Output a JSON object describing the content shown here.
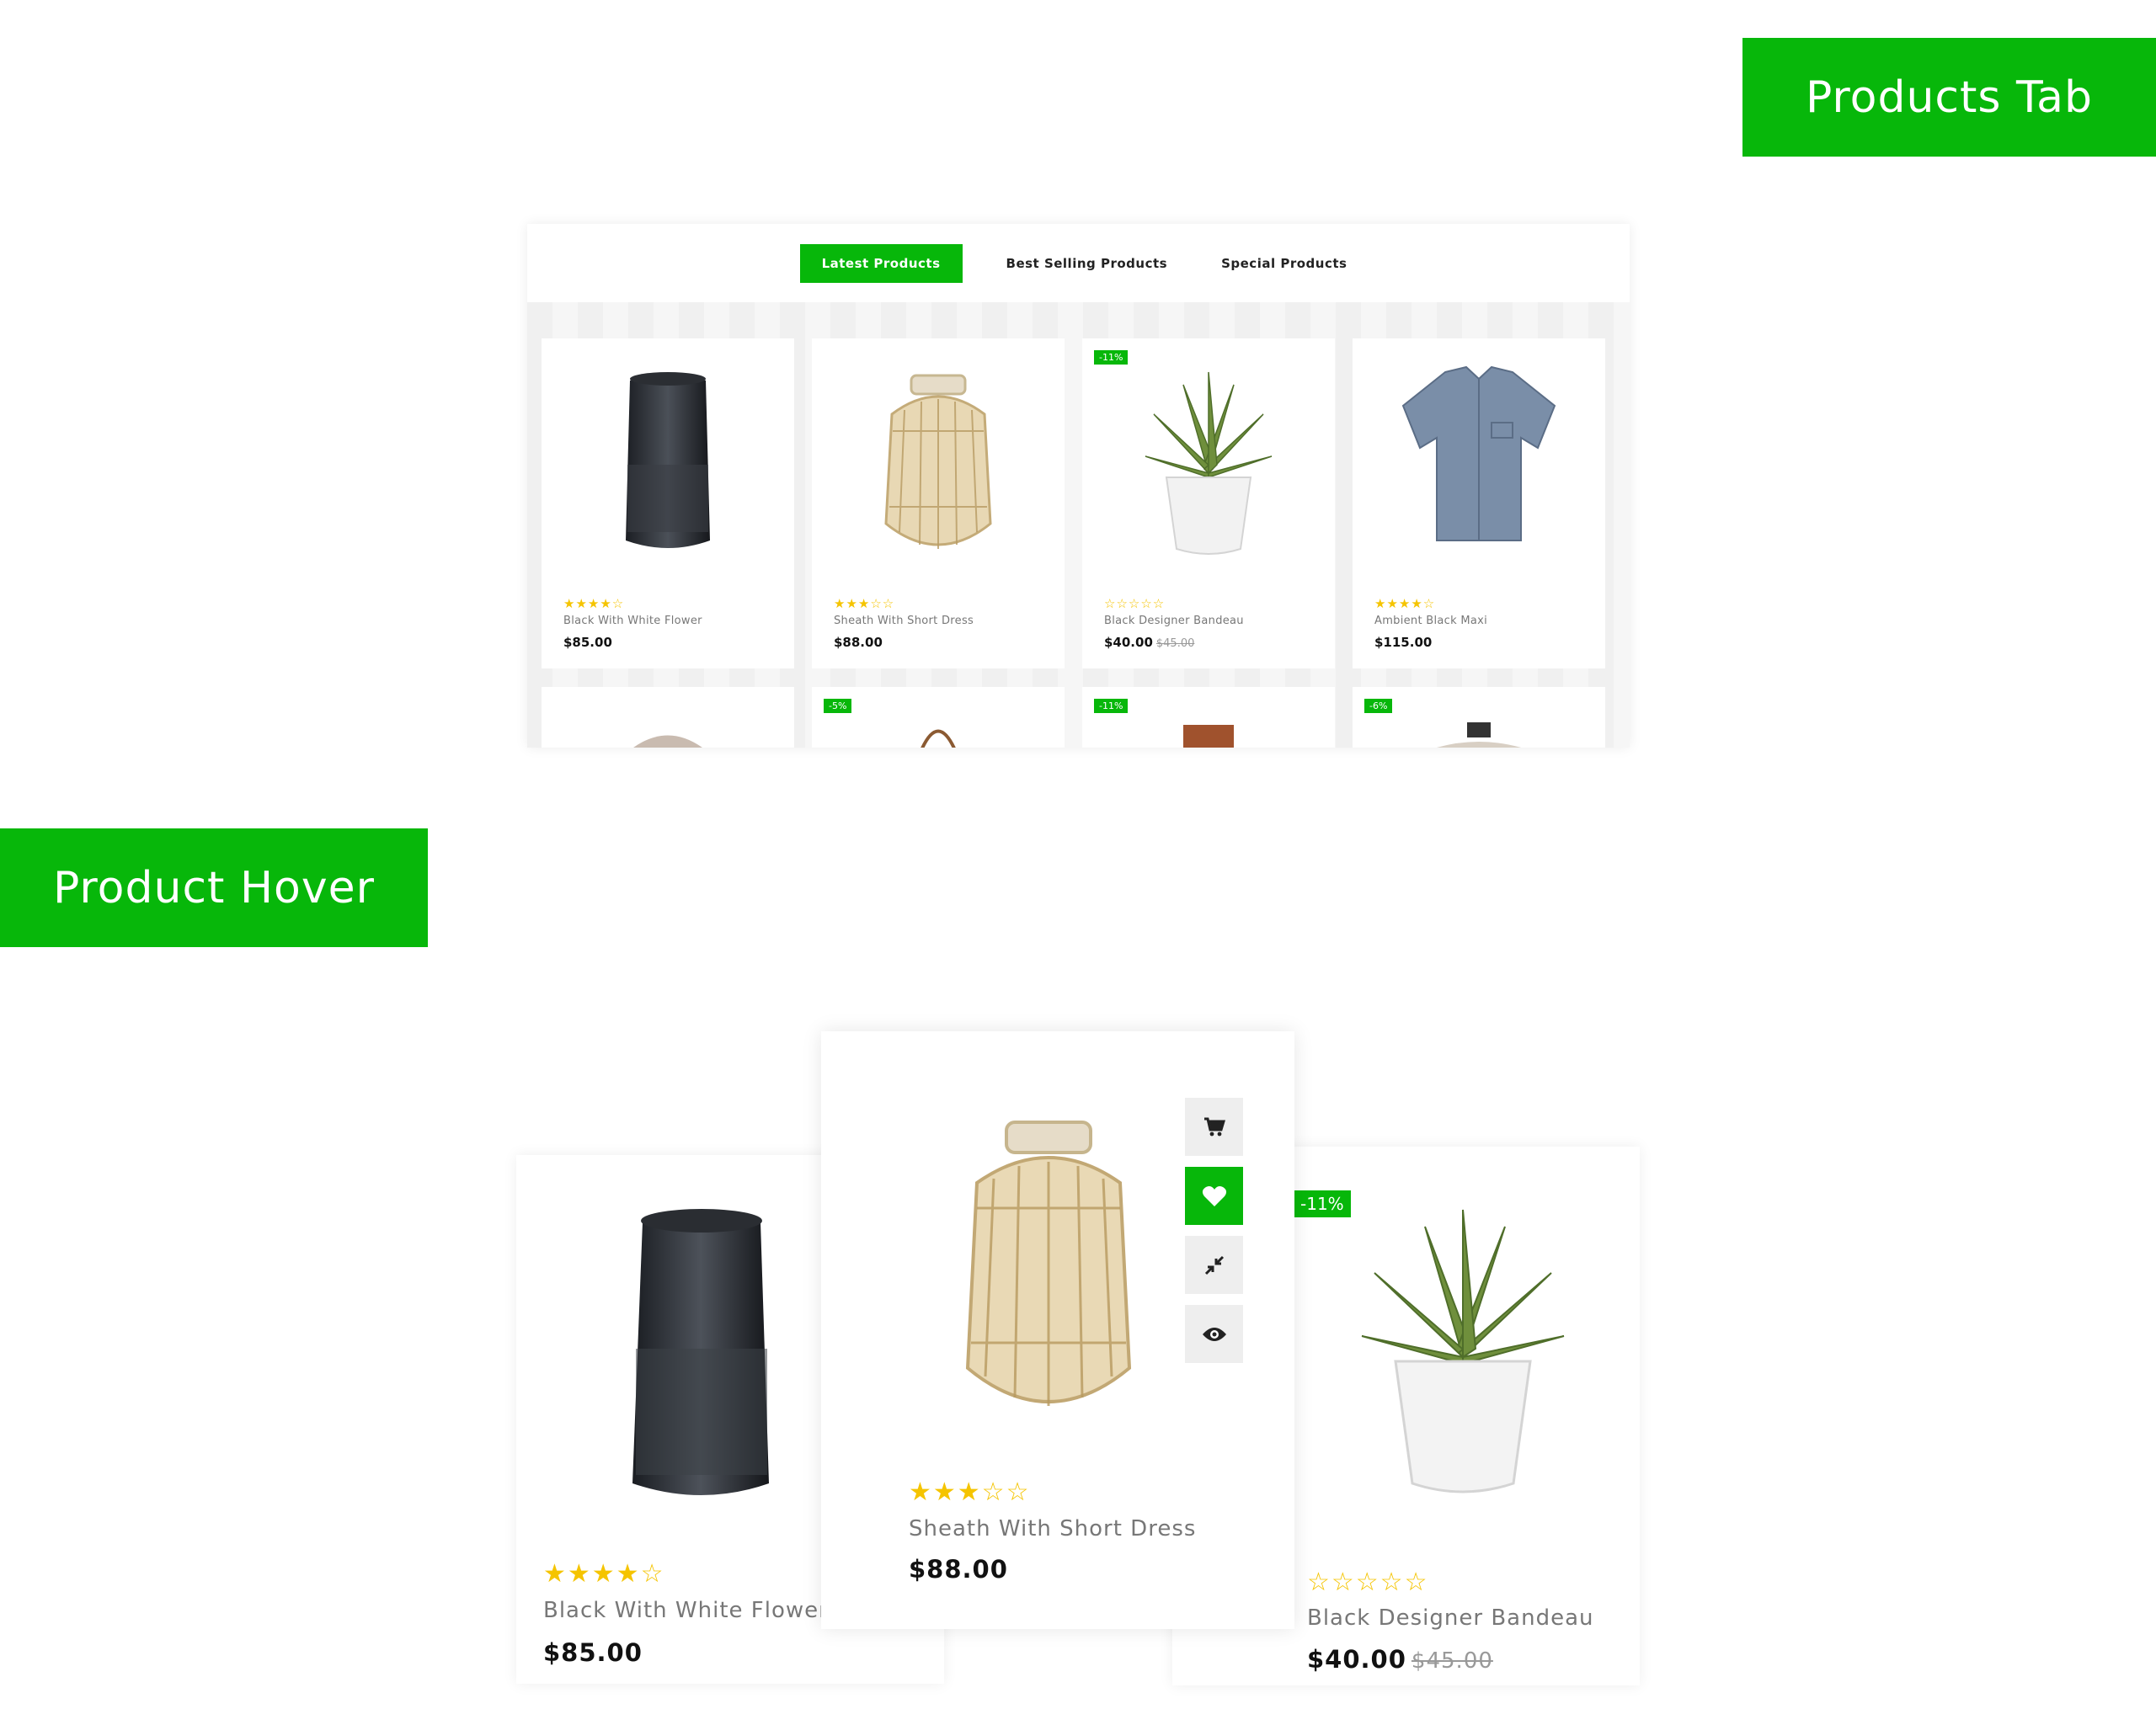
{
  "banners": {
    "products_tab": "Products Tab",
    "product_hover": "Product Hover"
  },
  "tabs": [
    {
      "label": "Latest Products",
      "active": true
    },
    {
      "label": "Best Selling Products",
      "active": false
    },
    {
      "label": "Special Products",
      "active": false
    }
  ],
  "grid_products": [
    {
      "name": "Black With White Flower",
      "price": "$85.00",
      "old_price": "",
      "stars": "★★★★☆",
      "rating": 4,
      "badge": "",
      "image": "speaker"
    },
    {
      "name": "Sheath With Short Dress",
      "price": "$88.00",
      "old_price": "",
      "stars": "★★★☆☆",
      "rating": 3,
      "badge": "",
      "image": "lantern"
    },
    {
      "name": "Black Designer Bandeau",
      "price": "$40.00",
      "old_price": "$45.00",
      "stars": "☆☆☆☆☆",
      "rating": 0,
      "badge": "-11%",
      "image": "plant"
    },
    {
      "name": "Ambient Black Maxi",
      "price": "$115.00",
      "old_price": "",
      "stars": "★★★★☆",
      "rating": 4,
      "badge": "",
      "image": "shirt"
    }
  ],
  "second_row_badges": [
    "",
    "-5%",
    "-11%",
    "-6%"
  ],
  "hover_products": [
    {
      "name": "Black With White Flower",
      "price": "$85.00",
      "old_price": "",
      "stars": "★★★★☆",
      "rating": 4,
      "badge": "",
      "image": "speaker"
    },
    {
      "name": "Sheath With Short Dress",
      "price": "$88.00",
      "old_price": "",
      "stars": "★★★☆☆",
      "rating": 3,
      "badge": "",
      "image": "lantern"
    },
    {
      "name": "Black Designer Bandeau",
      "price": "$40.00",
      "old_price": "$45.00",
      "stars": "☆☆☆☆☆",
      "rating": 0,
      "badge": "-11%",
      "image": "plant"
    }
  ],
  "hover_actions": [
    {
      "icon": "cart-icon",
      "active": false
    },
    {
      "icon": "heart-icon",
      "active": true
    },
    {
      "icon": "compare-icon",
      "active": false
    },
    {
      "icon": "eye-icon",
      "active": false
    }
  ],
  "colors": {
    "accent": "#07b70a",
    "star": "#f5c400",
    "text": "#111111",
    "muted": "#777777"
  }
}
